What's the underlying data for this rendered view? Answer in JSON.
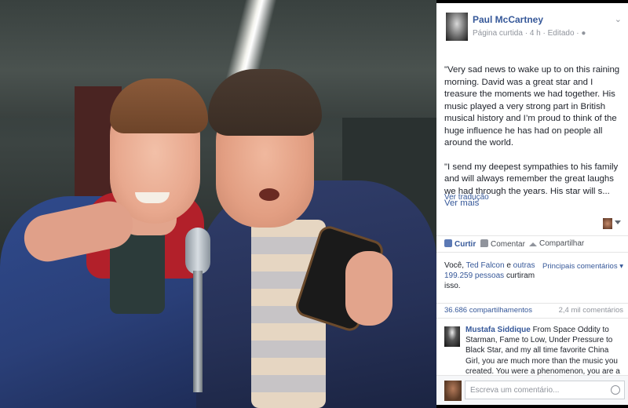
{
  "post": {
    "author": "Paul McCartney",
    "meta": "Página curtida · 4 h · Editado · ",
    "globe_icon": "globe-icon",
    "paragraph1": "\"Very sad news to wake up to on this raining morning. David was a great star and I treasure the moments we had together. His music played a very strong part in British musical history and I’m proud to think of the huge influence he has had on people all around the world.",
    "paragraph2": "\"I send my deepest sympathies to his family and will always remember the great laughs we had through the years. His star will s... ",
    "see_more": "Ver mais",
    "translate": "Ver tradução"
  },
  "actions": {
    "like": "Curtir",
    "comment": "Comentar",
    "share": "Compartilhar"
  },
  "likes": {
    "prefix": "Você, ",
    "friend": "Ted Falcon",
    "middle": " e ",
    "others": "outras 199.259 pessoas",
    "suffix": " curtiram isso."
  },
  "top_comments": "Principais comentários ▾",
  "stats": {
    "shares": "36.686 compartilhamentos",
    "comments": "2,4 mil comentários"
  },
  "comment": {
    "name": "Mustafa Siddique",
    "text": " From Space Oddity to Starman, Fame to Low, Under Pressure to Black Star, and my all time favorite China Girl, you are much more than the music you created. You were a phenomenon, you are a phenomenon and death"
  },
  "composer": {
    "placeholder": "Escreva um comentário..."
  }
}
